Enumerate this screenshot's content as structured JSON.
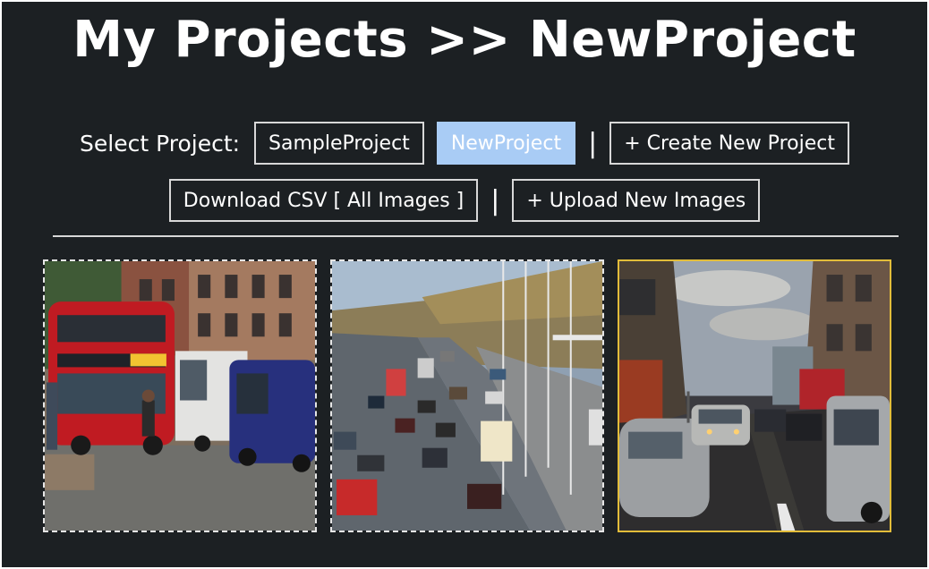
{
  "header": {
    "title": "My Projects >> NewProject"
  },
  "projects": {
    "select_label": "Select Project:",
    "items": [
      {
        "label": "SampleProject",
        "active": false
      },
      {
        "label": "NewProject",
        "active": true
      }
    ],
    "separator": "|",
    "create_label": "+ Create New Project"
  },
  "actions": {
    "download_label": "Download CSV [ All Images ]",
    "separator": "|",
    "upload_label": "+ Upload New Images"
  },
  "gallery": {
    "images": [
      {
        "subject": "red double-decker bus with cyclist and vans",
        "selected": false
      },
      {
        "subject": "highway with traffic under gantries",
        "selected": false
      },
      {
        "subject": "city street with cars at dusk",
        "selected": true
      }
    ]
  },
  "colors": {
    "background": "#1c2023",
    "active_button": "#a9ccf5",
    "selected_border": "#e2bd3a",
    "button_border": "#d8d8d8"
  }
}
